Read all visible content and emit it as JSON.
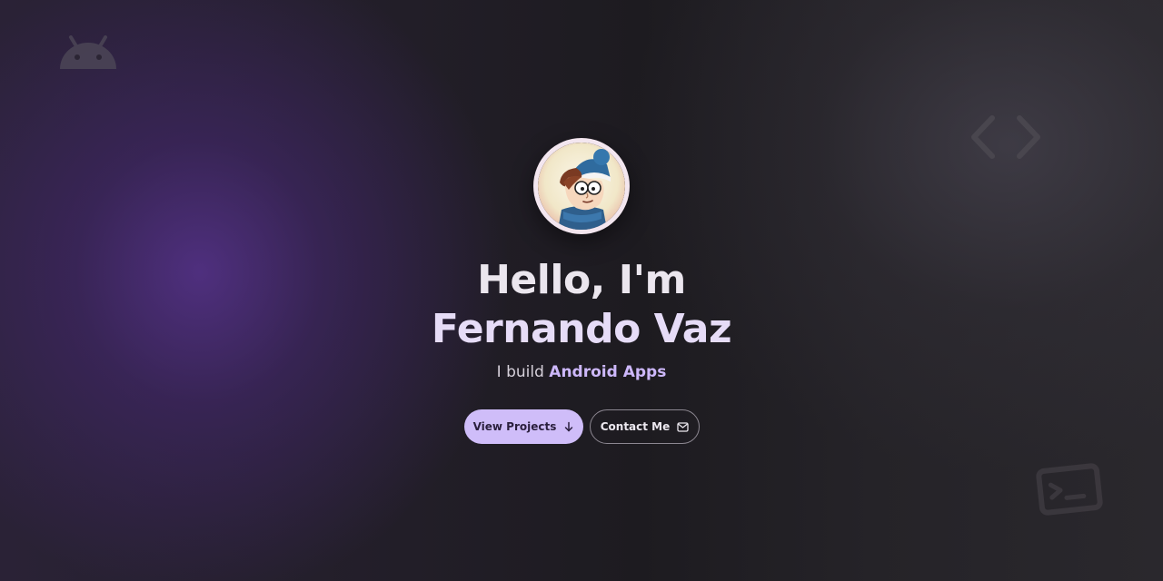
{
  "hero": {
    "greeting": "Hello, I'm",
    "name": "Fernando Vaz",
    "subtitle_prefix": "I build",
    "subtitle_highlight": "Android Apps",
    "avatar_alt": "Fernando Vaz avatar"
  },
  "buttons": {
    "view_projects": "View Projects",
    "contact_me": "Contact Me"
  },
  "icons": {
    "background_decorations": [
      "android-icon",
      "code-brackets-icon",
      "terminal-icon"
    ],
    "view_projects_icon": "arrow-down-icon",
    "contact_icon": "mail-icon"
  },
  "colors": {
    "accent": "#cfbdf9",
    "highlight_text": "#cdb8fb",
    "background": "#1f1d22",
    "purple_glow": "#56328c"
  }
}
